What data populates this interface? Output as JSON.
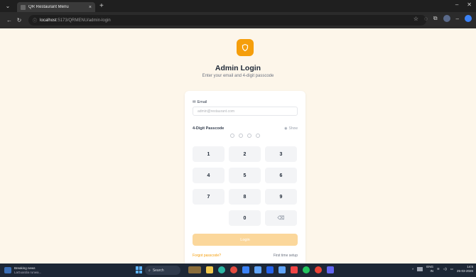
{
  "browser": {
    "tab_title": "QR Restaurant Menu",
    "tab_close": "×",
    "new_tab": "+",
    "url_host": "localhost",
    "url_rest": ":5173/QRMENU/admin-login"
  },
  "page": {
    "title": "Admin Login",
    "subtitle": "Enter your email and 4-digit passcode",
    "email_label": "Email",
    "email_placeholder": "admin@restaurant.com",
    "passcode_label": "4-Digit Passcode",
    "show_label": "Show",
    "keys": [
      "1",
      "2",
      "3",
      "4",
      "5",
      "6",
      "7",
      "8",
      "9",
      "",
      "0",
      "⌫"
    ],
    "login_button": "Login",
    "forgot_link": "Forgot passcode?",
    "first_time_link": "First time setup"
  },
  "taskbar": {
    "news_title": "Breaking news",
    "news_sub": "LaGuardia runwa...",
    "search_placeholder": "Search",
    "lang": "ENG",
    "lang2": "IN",
    "time": "14:5",
    "date": "25-03-2026"
  },
  "colors": {
    "accent": "#f59e0b",
    "login_disabled": "#fbd79b",
    "page_bg": "#fdf6ea"
  }
}
